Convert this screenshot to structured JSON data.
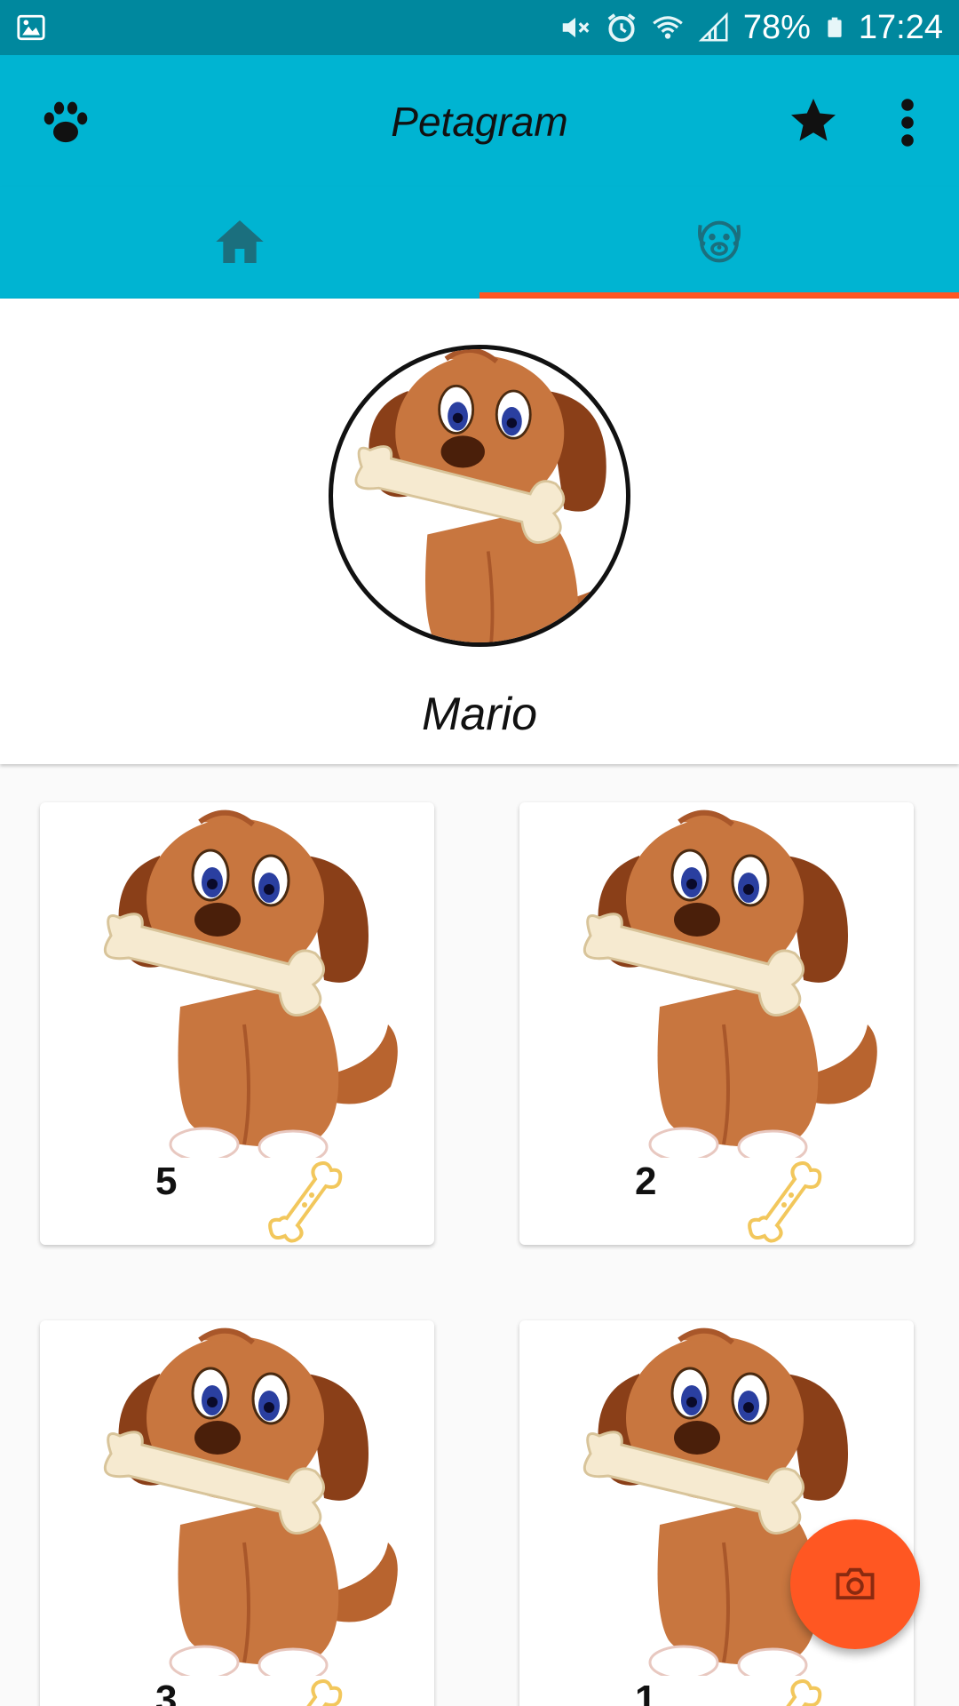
{
  "status_bar": {
    "battery": "78%",
    "time": "17:24",
    "icons": [
      "gallery-icon",
      "mute-icon",
      "alarm-icon",
      "wifi-icon",
      "signal-icon",
      "battery-icon"
    ]
  },
  "app_bar": {
    "title": "Petagram",
    "icons": [
      "paw-icon",
      "star-icon",
      "more-vert-icon"
    ]
  },
  "tabs": [
    {
      "icon": "home-icon",
      "selected": false
    },
    {
      "icon": "dog-face-icon",
      "selected": true
    }
  ],
  "profile": {
    "name": "Mario"
  },
  "photos": [
    {
      "likes": "5"
    },
    {
      "likes": "2"
    },
    {
      "likes": "3"
    },
    {
      "likes": "1"
    }
  ],
  "fab": {
    "icon": "camera-icon"
  },
  "colors": {
    "status_bar": "#00889e",
    "primary": "#00b4d2",
    "accent": "#ff5722",
    "tab_icon": "#1b6f7e",
    "bone": "#f2c75c"
  }
}
